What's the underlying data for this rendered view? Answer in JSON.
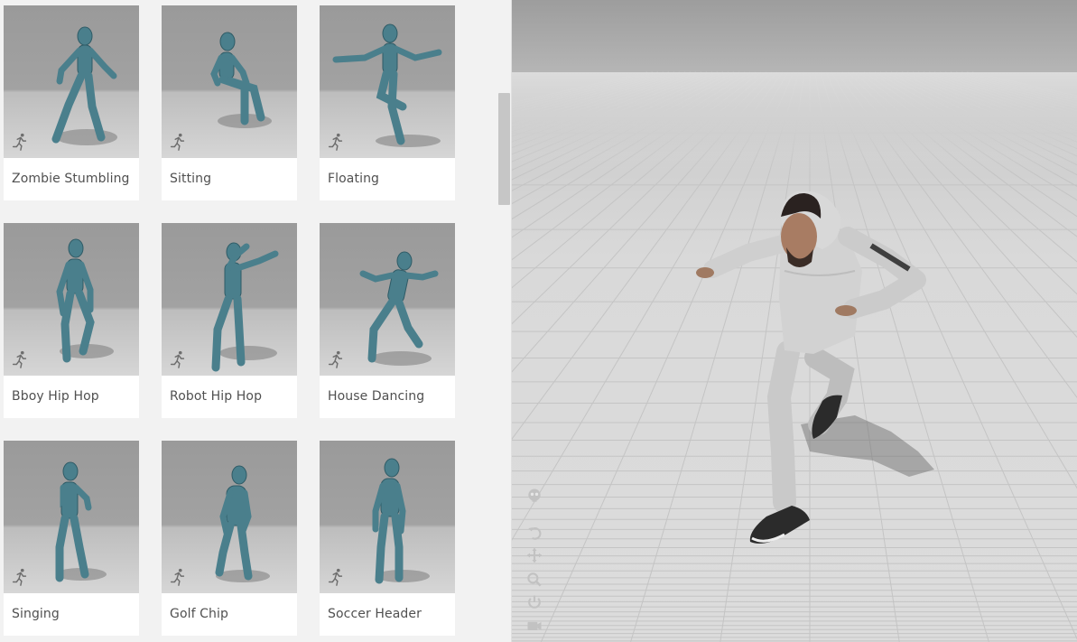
{
  "library": {
    "cards": [
      {
        "label": "Zombie Stumbling",
        "pose": "zombie"
      },
      {
        "label": "Sitting",
        "pose": "sitting"
      },
      {
        "label": "Floating",
        "pose": "floating"
      },
      {
        "label": "Bboy Hip Hop",
        "pose": "bboy"
      },
      {
        "label": "Robot Hip Hop",
        "pose": "robot"
      },
      {
        "label": "House Dancing",
        "pose": "house"
      },
      {
        "label": "Singing",
        "pose": "singing"
      },
      {
        "label": "Golf Chip",
        "pose": "golf"
      },
      {
        "label": "Soccer Header",
        "pose": "soccer"
      }
    ],
    "card_icon": "running-person-icon"
  },
  "viewport": {
    "tools": [
      {
        "name": "skeleton-toggle-icon"
      },
      {
        "name": "reset-view-icon"
      },
      {
        "name": "pan-icon"
      },
      {
        "name": "zoom-icon"
      },
      {
        "name": "power-icon"
      },
      {
        "name": "camera-icon"
      }
    ]
  },
  "colors": {
    "panel_bg": "#f2f2f2",
    "figure_teal": "#4a7f8c",
    "label_text": "#505050"
  }
}
